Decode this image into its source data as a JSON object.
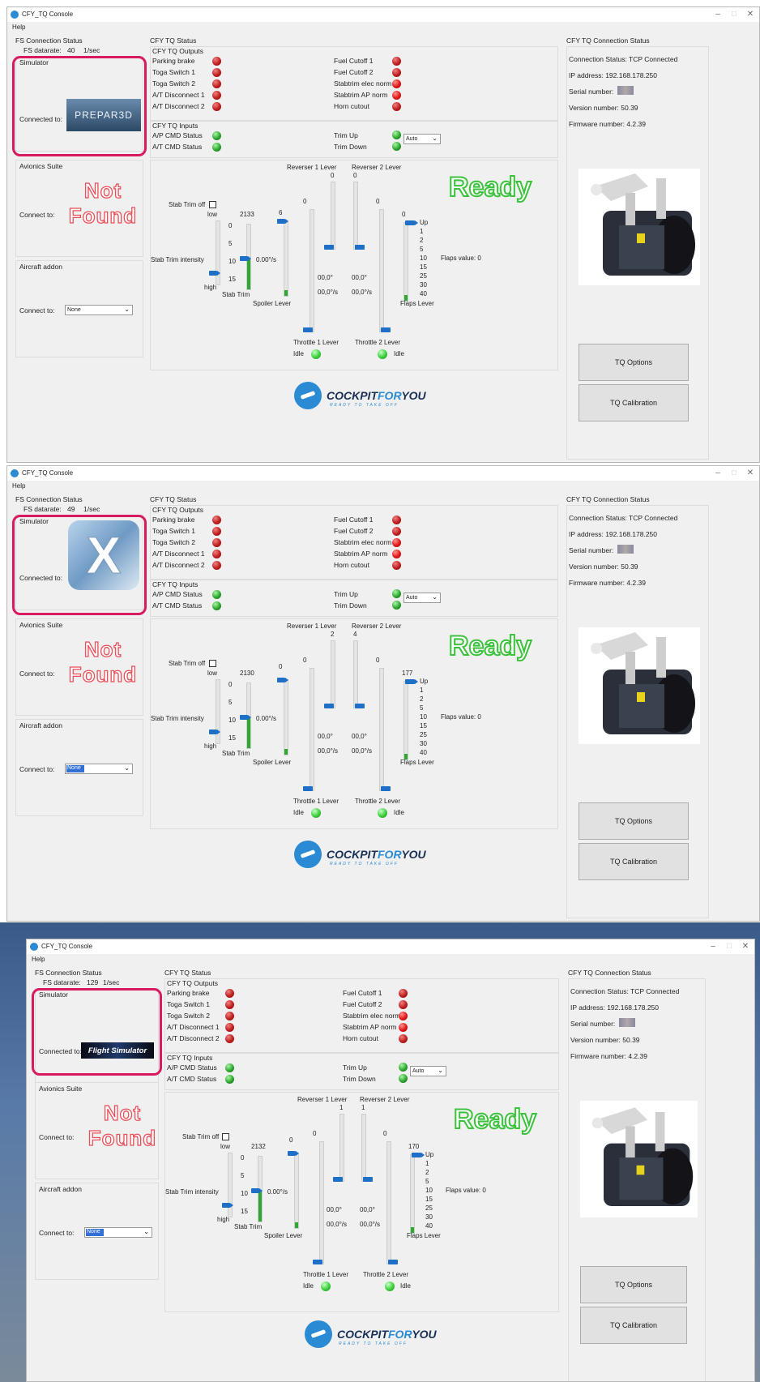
{
  "windows": [
    {
      "title": "CFY_TQ Console",
      "menu_help": "Help",
      "fs_connection_status": "FS Connection Status",
      "fs_datarate_label": "FS datarate:",
      "fs_datarate_value": "40",
      "fs_datarate_unit": "1/sec",
      "simulator_label": "Simulator",
      "connected_to_label": "Connected to:",
      "simulator_logo_text": "PREPAR3D",
      "avionics_suite_label": "Avionics Suite",
      "avionics_connect_label": "Connect to:",
      "not_found_text": "Not Found",
      "aircraft_addon_label": "Aircraft addon",
      "aircraft_connect_label": "Connect to:",
      "aircraft_select_value": "None",
      "tq_status_title": "CFY TQ Status",
      "tq_outputs_title": "CFY TQ Outputs",
      "outputs_left": [
        "Parking brake",
        "Toga Switch 1",
        "Toga Switch 2",
        "A/T Disconnect 1",
        "A/T Disconnect 2"
      ],
      "outputs_right": [
        "Fuel Cutoff 1",
        "Fuel Cutoff 2",
        "Stabtrim elec norm",
        "Stabtrim AP norm",
        "Horn cutout"
      ],
      "tq_inputs_title": "CFY TQ Inputs",
      "inputs_left": [
        "A/P CMD Status",
        "A/T CMD Status"
      ],
      "trim_up": "Trim Up",
      "trim_down": "Trim Down",
      "trim_mode_value": "Auto",
      "reverser1_label": "Reverser 1 Lever",
      "reverser2_label": "Reverser 2 Lever",
      "reverser1_value": "0",
      "reverser2_value": "0",
      "ready_text": "Ready",
      "stab_trim_off": "Stab Trim off",
      "low_label": "low",
      "high_label": "high",
      "stab_trim_value": "2133",
      "stab_trim_ticks": [
        "0",
        "5",
        "10",
        "15"
      ],
      "stab_trim_label": "Stab Trim",
      "stab_trim_intensity": "Stab Trim intensity",
      "stab_trim_rate": "0.00°/s",
      "spoiler_value": "6",
      "spoiler_label": "Spoiler Lever",
      "throttle1_value": "0",
      "throttle2_value": "0",
      "throttle1_label": "Throttle 1 Lever",
      "throttle2_label": "Throttle 2 Lever",
      "idle_label": "Idle",
      "angle1": "00,0°",
      "angle2": "00,0°",
      "rate1": "00,0°/s",
      "rate2": "00,0°/s",
      "flaps_value": "0",
      "flaps_ticks": [
        "Up",
        "1",
        "2",
        "5",
        "10",
        "15",
        "25",
        "30",
        "40"
      ],
      "flaps_label": "Flaps Lever",
      "flaps_value_label": "Flaps value: 0",
      "tq_connection_status_title": "CFY TQ Connection Status",
      "connection_status": "Connection Status: TCP Connected",
      "ip_address": "IP address: 192.168.178.250",
      "serial_number_label": "Serial number:",
      "version_number": "Version number: 50.39",
      "firmware_number": "Firmware number: 4.2.39",
      "tq_options": "TQ Options",
      "tq_calibration": "TQ Calibration",
      "brand_a": "COCKPIT",
      "brand_b": "FOR",
      "brand_c": "YOU",
      "brand_sub": "READY TO TAKE OFF"
    },
    {
      "title": "CFY_TQ Console",
      "menu_help": "Help",
      "fs_connection_status": "FS Connection Status",
      "fs_datarate_label": "FS datarate:",
      "fs_datarate_value": "49",
      "fs_datarate_unit": "1/sec",
      "simulator_label": "Simulator",
      "connected_to_label": "Connected to:",
      "simulator_logo_text": "X",
      "avionics_suite_label": "Avionics Suite",
      "avionics_connect_label": "Connect to:",
      "not_found_text": "Not Found",
      "aircraft_addon_label": "Aircraft addon",
      "aircraft_connect_label": "Connect to:",
      "aircraft_select_value": "None",
      "tq_status_title": "CFY TQ Status",
      "tq_outputs_title": "CFY TQ Outputs",
      "outputs_left": [
        "Parking brake",
        "Toga Switch 1",
        "Toga Switch 2",
        "A/T Disconnect 1",
        "A/T Disconnect 2"
      ],
      "outputs_right": [
        "Fuel Cutoff 1",
        "Fuel Cutoff 2",
        "Stabtrim elec norm",
        "Stabtrim AP norm",
        "Horn cutout"
      ],
      "tq_inputs_title": "CFY TQ Inputs",
      "inputs_left": [
        "A/P CMD Status",
        "A/T CMD Status"
      ],
      "trim_up": "Trim Up",
      "trim_down": "Trim Down",
      "trim_mode_value": "Auto",
      "reverser1_label": "Reverser 1 Lever",
      "reverser2_label": "Reverser 2 Lever",
      "reverser1_value": "2",
      "reverser2_value": "4",
      "ready_text": "Ready",
      "stab_trim_off": "Stab Trim off",
      "low_label": "low",
      "high_label": "high",
      "stab_trim_value": "2130",
      "stab_trim_ticks": [
        "0",
        "5",
        "10",
        "15"
      ],
      "stab_trim_label": "Stab Trim",
      "stab_trim_intensity": "Stab Trim intensity",
      "stab_trim_rate": "0.00°/s",
      "spoiler_value": "0",
      "spoiler_label": "Spoiler Lever",
      "throttle1_value": "0",
      "throttle2_value": "0",
      "throttle1_label": "Throttle 1 Lever",
      "throttle2_label": "Throttle 2 Lever",
      "idle_label": "Idle",
      "angle1": "00,0°",
      "angle2": "00,0°",
      "rate1": "00,0°/s",
      "rate2": "00,0°/s",
      "flaps_value": "177",
      "flaps_ticks": [
        "Up",
        "1",
        "2",
        "5",
        "10",
        "15",
        "25",
        "30",
        "40"
      ],
      "flaps_label": "Flaps Lever",
      "flaps_value_label": "Flaps value: 0",
      "tq_connection_status_title": "CFY TQ Connection Status",
      "connection_status": "Connection Status: TCP Connected",
      "ip_address": "IP address: 192.168.178.250",
      "serial_number_label": "Serial number:",
      "version_number": "Version number: 50.39",
      "firmware_number": "Firmware number: 4.2.39",
      "tq_options": "TQ Options",
      "tq_calibration": "TQ Calibration",
      "brand_a": "COCKPIT",
      "brand_b": "FOR",
      "brand_c": "YOU",
      "brand_sub": "READY TO TAKE OFF"
    },
    {
      "title": "CFY_TQ Console",
      "menu_help": "Help",
      "fs_connection_status": "FS Connection Status",
      "fs_datarate_label": "FS datarate:",
      "fs_datarate_value": "129",
      "fs_datarate_unit": "1/sec",
      "simulator_label": "Simulator",
      "connected_to_label": "Connected to:",
      "simulator_logo_text": "Flight Simulator",
      "avionics_suite_label": "Avionics Suite",
      "avionics_connect_label": "Connect to:",
      "not_found_text": "Not Found",
      "aircraft_addon_label": "Aircraft addon",
      "aircraft_connect_label": "Connect to:",
      "aircraft_select_value": "None",
      "tq_status_title": "CFY TQ Status",
      "tq_outputs_title": "CFY TQ Outputs",
      "outputs_left": [
        "Parking brake",
        "Toga Switch 1",
        "Toga Switch 2",
        "A/T Disconnect 1",
        "A/T Disconnect 2"
      ],
      "outputs_right": [
        "Fuel Cutoff 1",
        "Fuel Cutoff 2",
        "Stabtrim elec norm",
        "Stabtrim AP norm",
        "Horn cutout"
      ],
      "tq_inputs_title": "CFY TQ Inputs",
      "inputs_left": [
        "A/P CMD Status",
        "A/T CMD Status"
      ],
      "trim_up": "Trim Up",
      "trim_down": "Trim Down",
      "trim_mode_value": "Auto",
      "reverser1_label": "Reverser 1 Lever",
      "reverser2_label": "Reverser 2 Lever",
      "reverser1_value": "1",
      "reverser2_value": "1",
      "ready_text": "Ready",
      "stab_trim_off": "Stab Trim off",
      "low_label": "low",
      "high_label": "high",
      "stab_trim_value": "2132",
      "stab_trim_ticks": [
        "0",
        "5",
        "10",
        "15"
      ],
      "stab_trim_label": "Stab Trim",
      "stab_trim_intensity": "Stab Trim intensity",
      "stab_trim_rate": "0.00°/s",
      "spoiler_value": "0",
      "spoiler_label": "Spoiler Lever",
      "throttle1_value": "0",
      "throttle2_value": "0",
      "throttle1_label": "Throttle 1 Lever",
      "throttle2_label": "Throttle 2 Lever",
      "idle_label": "Idle",
      "angle1": "00,0°",
      "angle2": "00,0°",
      "rate1": "00,0°/s",
      "rate2": "00,0°/s",
      "flaps_value": "170",
      "flaps_ticks": [
        "Up",
        "1",
        "2",
        "5",
        "10",
        "15",
        "25",
        "30",
        "40"
      ],
      "flaps_label": "Flaps Lever",
      "flaps_value_label": "Flaps value: 0",
      "tq_connection_status_title": "CFY TQ Connection Status",
      "connection_status": "Connection Status: TCP Connected",
      "ip_address": "IP address: 192.168.178.250",
      "serial_number_label": "Serial number:",
      "version_number": "Version number: 50.39",
      "firmware_number": "Firmware number: 4.2.39",
      "tq_options": "TQ Options",
      "tq_calibration": "TQ Calibration",
      "brand_a": "COCKPIT",
      "brand_b": "FOR",
      "brand_c": "YOU",
      "brand_sub": "READY TO TAKE OFF"
    }
  ],
  "colors": {
    "accent_pink": "#d81b60",
    "not_found": "#e8505a",
    "ready": "#3cc23c",
    "slider_blue": "#1e6fc8",
    "brand_blue": "#2a8ad4"
  }
}
